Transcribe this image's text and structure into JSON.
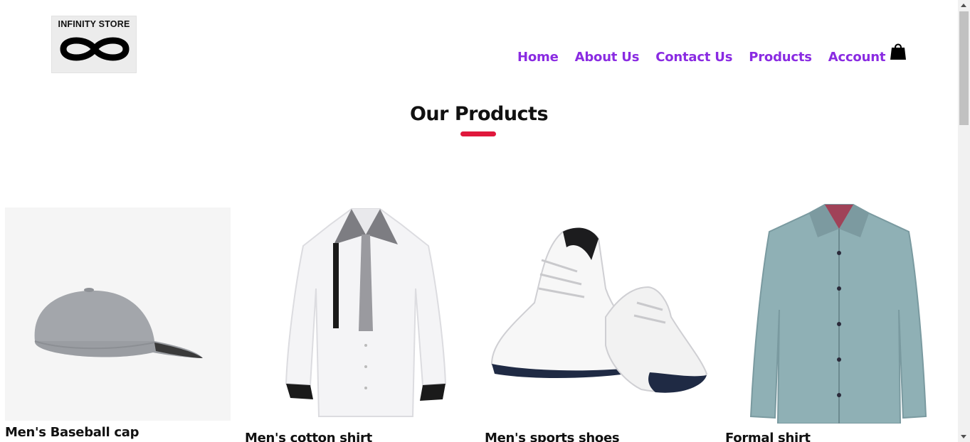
{
  "brand": {
    "logo_text": "INFINITY STORE",
    "logo_icon": "infinity-icon"
  },
  "nav": {
    "items": [
      {
        "label": "Home"
      },
      {
        "label": "About Us"
      },
      {
        "label": "Contact Us"
      },
      {
        "label": "Products"
      },
      {
        "label": "Account"
      }
    ],
    "cart_icon": "shopping-bag-icon",
    "link_color": "#8a2be2"
  },
  "section": {
    "title": "Our Products",
    "accent_color": "#e0183c"
  },
  "products": [
    {
      "name": "Men's Baseball cap",
      "image_icon": "baseball-cap-image"
    },
    {
      "name": "Men's cotton shirt",
      "image_icon": "white-shirt-image"
    },
    {
      "name": "Men's sports shoes",
      "image_icon": "sports-shoes-image"
    },
    {
      "name": "Formal shirt",
      "image_icon": "formal-shirt-image"
    }
  ]
}
